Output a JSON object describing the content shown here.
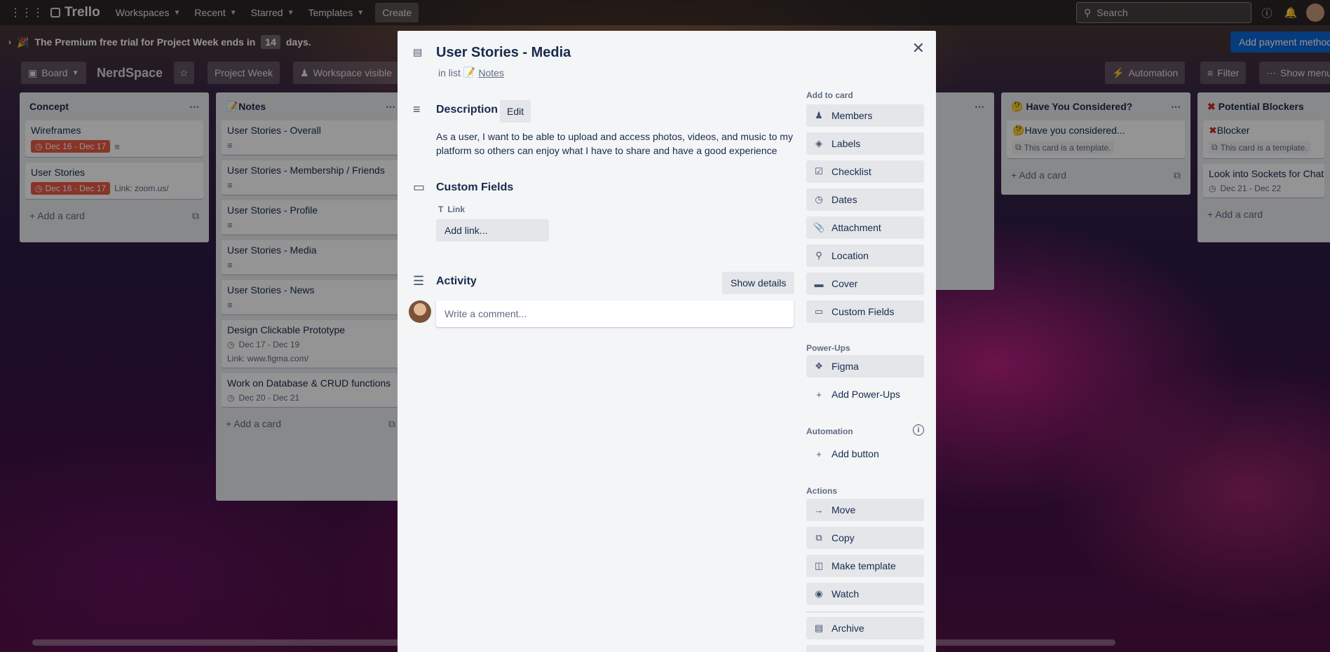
{
  "topbar": {
    "brand": "Trello",
    "workspaces": "Workspaces",
    "recent": "Recent",
    "starred": "Starred",
    "templates": "Templates",
    "create": "Create",
    "search_placeholder": "Search"
  },
  "banner": {
    "prefix": "The Premium free trial for Project Week ends in",
    "days": "14",
    "suffix": "days.",
    "pay": "Add payment method"
  },
  "board": {
    "view": "Board",
    "name": "NerdSpace",
    "project": "Project Week",
    "visibility": "Workspace visible",
    "automation": "Automation",
    "filter": "Filter",
    "show_menu": "Show menu"
  },
  "lists": {
    "concept": {
      "title": "Concept",
      "cards": [
        {
          "title": "Wireframes",
          "due": "Dec 16 - Dec 17"
        },
        {
          "title": "User Stories",
          "due": "Dec 16 - Dec 17",
          "link": "Link: zoom.us/"
        }
      ],
      "add": "Add a card"
    },
    "notes": {
      "title": "Notes",
      "cards": [
        {
          "title": "User Stories - Overall"
        },
        {
          "title": "User Stories - Membership / Friends"
        },
        {
          "title": "User Stories - Profile"
        },
        {
          "title": "User Stories - Media"
        },
        {
          "title": "User Stories - News"
        },
        {
          "title": "Design Clickable Prototype",
          "dates": "Dec 17 - Dec 19",
          "link": "Link: www.figma.com/"
        },
        {
          "title": "Work on Database & CRUD functions",
          "dates": "Dec 20 - Dec 21"
        }
      ],
      "add": "Add a card"
    },
    "considered": {
      "title": "Have You Considered?",
      "card": "Have you considered...",
      "template": "This card is a template.",
      "add": "Add a card"
    },
    "blockers": {
      "title": "Potential Blockers",
      "card1": "Blocker",
      "template": "This card is a template.",
      "card2": "Look into Sockets for Chat F",
      "card2_dates": "Dec 21 - Dec 22",
      "add": "Add a card"
    }
  },
  "modal": {
    "title": "User Stories - Media",
    "in_list": "in list",
    "list_name": "Notes",
    "description_title": "Description",
    "edit": "Edit",
    "description": "As a user, I want to be able to upload and access photos, videos, and music to my platform so others can enjoy what I have to share and have a good experience",
    "custom_fields_title": "Custom Fields",
    "link_label": "Link",
    "link_placeholder": "Add link...",
    "activity_title": "Activity",
    "show_details": "Show details",
    "comment_placeholder": "Write a comment...",
    "sidebar": {
      "add_to_card": "Add to card",
      "members": "Members",
      "labels": "Labels",
      "checklist": "Checklist",
      "dates": "Dates",
      "attachment": "Attachment",
      "location": "Location",
      "cover": "Cover",
      "custom_fields": "Custom Fields",
      "power_ups": "Power-Ups",
      "figma": "Figma",
      "add_power_ups": "Add Power-Ups",
      "automation": "Automation",
      "add_button": "Add button",
      "actions": "Actions",
      "move": "Move",
      "copy": "Copy",
      "make_template": "Make template",
      "watch": "Watch",
      "archive": "Archive"
    }
  }
}
